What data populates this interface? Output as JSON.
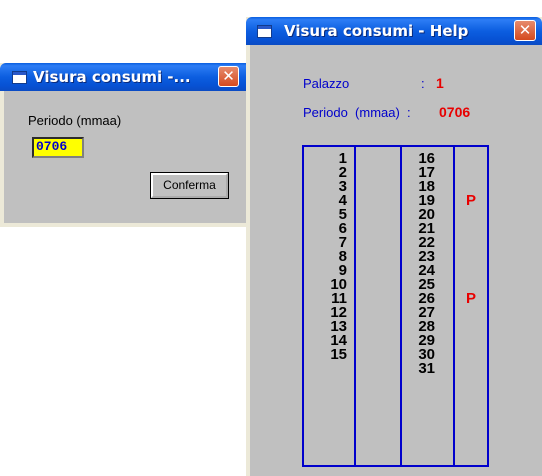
{
  "small_window": {
    "title": "Visura consumi -...",
    "close_glyph": "✕",
    "period_label": "Periodo (mmaa)",
    "period_value": "0706",
    "confirm_label": "Conferma"
  },
  "help_window": {
    "title": "Visura consumi - Help",
    "close_glyph": "✕",
    "palazzo_label": "Palazzo",
    "palazzo_sep": ":",
    "palazzo_value": "1",
    "period_label": "Periodo  (mmaa)  :",
    "period_value": "0706",
    "days_col1": [
      "1",
      "2",
      "3",
      "4",
      "5",
      "6",
      "7",
      "8",
      "9",
      "10",
      "11",
      "12",
      "13",
      "14",
      "15"
    ],
    "marks_col1": [
      "",
      "",
      "",
      "",
      "",
      "",
      "",
      "",
      "",
      "",
      "",
      "",
      "",
      "",
      ""
    ],
    "days_col2": [
      "16",
      "17",
      "18",
      "19",
      "20",
      "21",
      "22",
      "23",
      "24",
      "25",
      "26",
      "27",
      "28",
      "29",
      "30",
      "31"
    ],
    "marks_col2": [
      "",
      "",
      "",
      "P",
      "",
      "",
      "",
      "",
      "",
      "",
      "P",
      "",
      "",
      "",
      "",
      ""
    ]
  },
  "icons": [
    "window-icon",
    "close-icon"
  ],
  "colors": {
    "label_blue": "#0000cc",
    "value_red": "#e80000",
    "highlight_yellow": "#ffff00",
    "grid_blue": "#0000cc"
  }
}
